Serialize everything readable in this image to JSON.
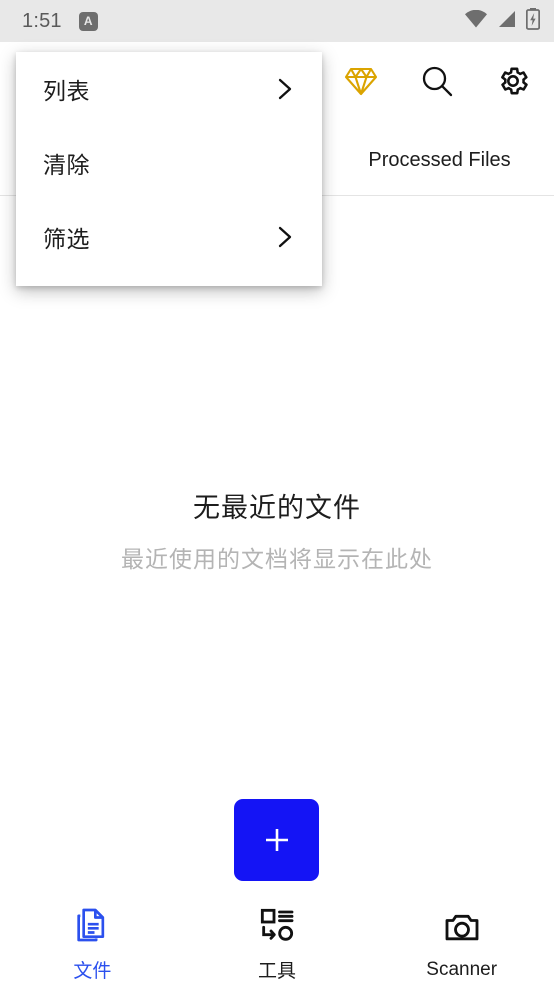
{
  "status_bar": {
    "clock": "1:51",
    "ime_badge": "A",
    "icons": [
      "wifi-icon",
      "cellular-signal-icon",
      "battery-charging-icon"
    ]
  },
  "app_bar": {
    "actions": [
      {
        "name": "premium-diamond-icon",
        "label": "Premium"
      },
      {
        "name": "search-icon",
        "label": "Search"
      },
      {
        "name": "settings-gear-icon",
        "label": "Settings"
      }
    ]
  },
  "tabs": [
    {
      "label": "Processed Files",
      "selected": false
    }
  ],
  "dropdown_menu": {
    "items": [
      {
        "label": "列表",
        "has_chevron": true
      },
      {
        "label": "清除",
        "has_chevron": false
      },
      {
        "label": "筛选",
        "has_chevron": true
      }
    ]
  },
  "empty_state": {
    "title": "无最近的文件",
    "subtitle": "最近使用的文档将显示在此处"
  },
  "fab": {
    "label": "+",
    "name": "add-file-button"
  },
  "bottom_nav": {
    "items": [
      {
        "label": "文件",
        "icon": "documents-icon",
        "active": true
      },
      {
        "label": "工具",
        "icon": "tools-icon",
        "active": false
      },
      {
        "label": "Scanner",
        "icon": "camera-icon",
        "active": false
      }
    ]
  },
  "colors": {
    "accent_blue": "#2b50ee",
    "fab_blue": "#1414f5",
    "premium_gold": "#dba400",
    "status_bar_bg": "#e8e8e8",
    "text_primary": "#1d1d1d",
    "text_muted": "#b4b4b4"
  }
}
